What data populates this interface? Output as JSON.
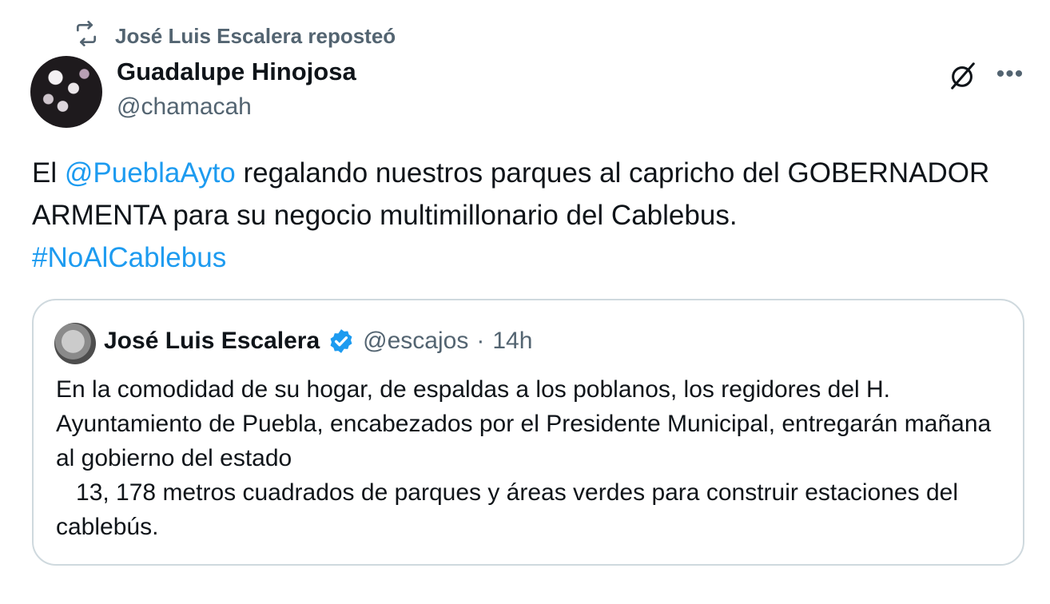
{
  "repost": {
    "icon": "repost-icon",
    "text": "José Luis Escalera reposteó"
  },
  "author": {
    "name": "Guadalupe Hinojosa",
    "handle": "@chamacah"
  },
  "tweet": {
    "text_part1": "El ",
    "mention": "@PueblaAyto",
    "text_part2": " regalando nuestros parques al capricho del GOBERNADOR ARMENTA para su negocio multimillonario del Cablebus.",
    "hashtag": "#NoAlCablebus"
  },
  "quote": {
    "name": "José Luis Escalera",
    "handle": "@escajos",
    "separator": "·",
    "time": "14h",
    "text": "En la comodidad de su hogar, de espaldas a los poblanos, los regidores del H. Ayuntamiento de Puebla, encabezados por el Presidente Municipal, entregarán mañana al gobierno del estado\n   13, 178 metros cuadrados de parques y áreas verdes para construir estaciones del cablebús."
  },
  "colors": {
    "link": "#1d9bf0",
    "secondary_text": "#536471",
    "border": "#cfd9de",
    "verified": "#1d9bf0"
  }
}
